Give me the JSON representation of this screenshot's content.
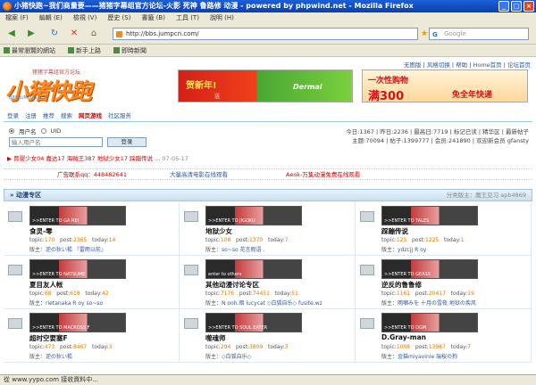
{
  "window": {
    "title": "小猪快跑~我们商量要——猪猪字幕组官方论坛-火影 死神 鲁路修 动漫 - powered by phpwind.net - Mozilla Firefox"
  },
  "menu": [
    "檔案 (F)",
    "編輯 (E)",
    "檢視 (V)",
    "歷史 (S)",
    "書籤 (B)",
    "工具 (T)",
    "說明 (H)"
  ],
  "address": {
    "url": "http://bbs.jumpcn.com/"
  },
  "search": {
    "placeholder": "Google"
  },
  "bookmarks": [
    "最常瀏覽的網站",
    "新手上路",
    "即時新聞"
  ],
  "header": {
    "toplinks": [
      "无图版",
      "风格切换",
      "帮助",
      "Home首页",
      "论坛首页"
    ],
    "logo_sub": "猪猪字幕组官方论坛",
    "logo_text": "小猪快跑",
    "logo_domain": "BBS.JUMPCN.COM",
    "banner1": {
      "t1": "贺新年!",
      "t2": "送",
      "t3": "Dermal"
    },
    "banner2": {
      "t1": "一次性购物",
      "t2": "满300",
      "t3": "免全年快递"
    }
  },
  "tabs": [
    "登录",
    "注册",
    "推荐",
    "搜索",
    "网页游戏",
    "社区服务"
  ],
  "login": {
    "username_label": "用户名",
    "uid_label": "UID",
    "username_placeholder": "输入用户名",
    "login_button": "登录"
  },
  "stats": {
    "line1": "今日:1367 | 昨日:2236 | 最高日:7719 | 标记已读 | 精华区 | 最新帖子",
    "line2": "主题:70094 | 帖子:1399777 | 会员:241890 | 欢迎新会员 gfansty"
  },
  "news": {
    "text": "育婴少女04 嘉达17 海贼王387 地狱少女17 踩蹦传说 ...",
    "date": "07-05-17"
  },
  "ads": [
    "广告联系qq：448482641",
    "大量高清电影在线观看",
    "Aeok-万集动漫免费在线观看"
  ],
  "category": {
    "title": "» 动漫专区",
    "moderators": "分类版主：魔王见习 apb4869"
  },
  "forums": [
    {
      "name": "食灵-零",
      "img_label": ">>ENTER TO GA REI",
      "topic": "170",
      "post": "2365",
      "today": "14",
      "mods": "逆の狄い狐 『雷雨以前』"
    },
    {
      "name": "地狱少女",
      "img_label": ">>ENTER TO JIGOKU",
      "topic": "108",
      "post": "1370",
      "today": "7",
      "mods": "so~so 花言假语 ."
    },
    {
      "name": "踩蹦传说",
      "img_label": ">>ENTER TO TALES",
      "topic": "125",
      "post": "1225",
      "today": "1",
      "mods": "ydzcjj R oy"
    },
    {
      "name": "夏目友人帐",
      "img_label": ">>ENTER TO NATSUME",
      "topic": "68",
      "post": "618",
      "today": "42",
      "mods": "rietanaka R oy so~so"
    },
    {
      "name": "其他动漫讨论专区",
      "img_label": "enter to others",
      "topic": "7176",
      "post": "74451",
      "today": "51",
      "mods": "N ooh.暗 lucycat ◇白狐自乐◇ fusite.wz"
    },
    {
      "name": "逆反的鲁鲁修",
      "img_label": ">>ENTER TO GEASS",
      "topic": "1161",
      "post": "20417",
      "today": "19",
      "mods": "雨嘲みを 十月の雪夜 地狱の疾风"
    },
    {
      "name": "超时空要塞F",
      "img_label": ">>ENTER TO MACROSS F",
      "topic": "473",
      "post": "8467",
      "today": "3",
      "mods": "逆の狄い狐"
    },
    {
      "name": "噬魂师",
      "img_label": ">>ENTER TO SOUL EATER",
      "topic": "294",
      "post": "3809",
      "today": "3",
      "mods": "◇白狐自乐◇"
    },
    {
      "name": "D.Gray-man",
      "img_label": ">>ENTER TO DGM",
      "topic": "1008",
      "post": "13987",
      "today": "7",
      "mods": "金猫miyavinie 瑞桜の狗"
    }
  ],
  "status": "從 www.yypo.com 接收資料中...",
  "colors": {
    "titlebar": "#0a3fae",
    "chrome": "#ece9d8",
    "accent": "#ff8a1f",
    "link": "#2a5aa6",
    "hot": "#cc0000"
  }
}
